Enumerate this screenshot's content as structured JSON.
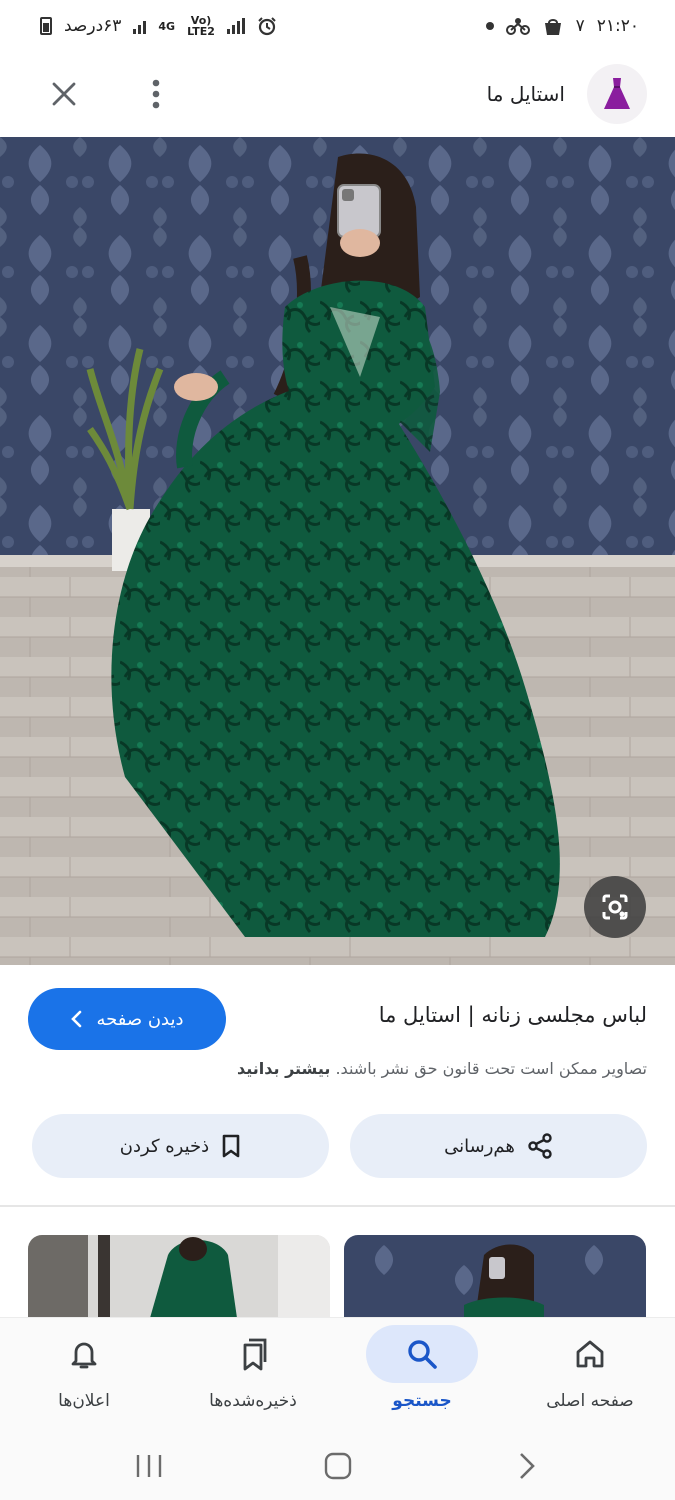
{
  "status_bar": {
    "time": "۲۱:۲۰",
    "carrier_count": "۷",
    "battery_text": "۶۳درصد",
    "network_label_top": "Vo)",
    "network_label_bottom": "LTE2",
    "network_type": "4G",
    "icons": [
      "dot-icon",
      "bike-icon",
      "shopping-bag-icon",
      "alarm-icon",
      "signal-icon",
      "battery-icon"
    ]
  },
  "header": {
    "site_name": "استایل ما",
    "logo_icon": "dress-logo-icon",
    "menu_icon": "more-vert-icon",
    "close_icon": "close-icon"
  },
  "result": {
    "title": "لباس مجلسی زنانه | استایل ما",
    "visit_label": "دیدن صفحه",
    "copyright_text": "تصاویر ممکن است تحت قانون حق نشر باشند.",
    "learn_more": "بیشتر بدانید",
    "share_label": "هم‌رسانی",
    "save_label": "ذخیره کردن"
  },
  "bottom_nav": {
    "items": [
      {
        "label": "صفحه اصلی",
        "icon": "home-icon"
      },
      {
        "label": "جستجو",
        "icon": "search-icon"
      },
      {
        "label": "ذخیره‌شده‌ها",
        "icon": "bookmarks-icon"
      },
      {
        "label": "اعلان‌ها",
        "icon": "bell-icon"
      }
    ],
    "active_index": 1
  },
  "colors": {
    "accent": "#1a73e8",
    "pill_bg": "#e8eef8",
    "dress_green": "#0f5a3e"
  }
}
